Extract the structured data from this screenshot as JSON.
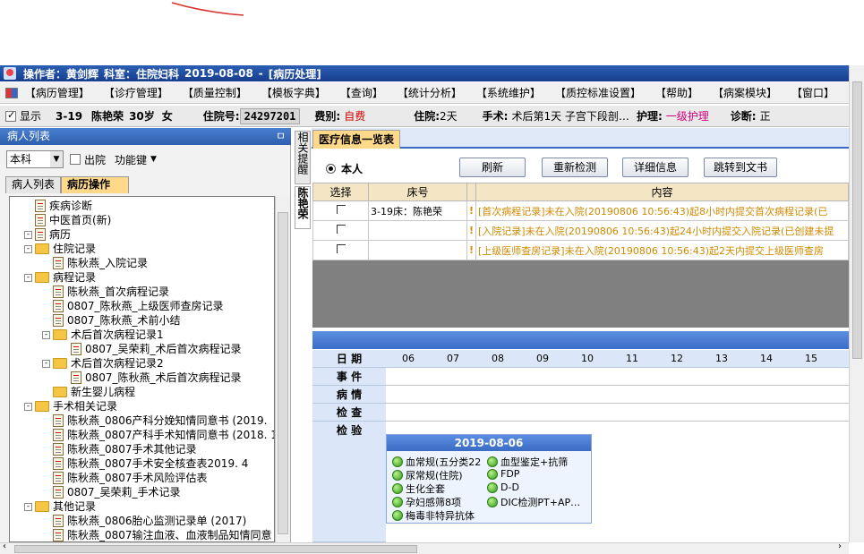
{
  "titlebar": {
    "operator": "操作者：黄剑辉",
    "dept": "科室：住院妇科",
    "date": "2019-08-08",
    "sep": "-",
    "mode": "[病历处理]"
  },
  "menubar": [
    "【病历管理】",
    "【诊疗管理】",
    "【质量控制】",
    "【模板字典】",
    "【查询】",
    "【统计分析】",
    "【系统维护】",
    "【质控标准设置】",
    "【帮助】",
    "【病案模块】",
    "【窗口】"
  ],
  "infobar": {
    "show_label": "显示",
    "bed": "3-19",
    "patient_name": "陈艳荣",
    "age": "30岁",
    "sex": "女",
    "admission_no_label": "住院号:",
    "admission_no": "24297201",
    "fee_type_label": "费别:",
    "fee_type": "自费",
    "stay_label": "住院:",
    "stay": "2天",
    "surgery_label": "手术:",
    "surgery": "术后第1天  子宫下段剖…",
    "care_label": "护理:",
    "care": "一级护理",
    "diagnosis_label": "诊断:",
    "diagnosis": "正"
  },
  "left": {
    "header": "病人列表",
    "pin": "ㅁ",
    "dept_select": "本科",
    "discharged_label": "出院",
    "function_key": "功能键",
    "tabs": [
      "病人列表",
      "病历操作"
    ],
    "tree": [
      {
        "label": "疾病诊断",
        "type": "doc",
        "level": 1
      },
      {
        "label": "中医首页(新)",
        "type": "doc",
        "level": 1
      },
      {
        "label": "病历",
        "type": "doc",
        "level": 1,
        "expand": "-"
      },
      {
        "label": "住院记录",
        "type": "folder",
        "level": 2,
        "expand": "-"
      },
      {
        "label": "陈秋燕_入院记录",
        "type": "doc",
        "level": 3
      },
      {
        "label": "病程记录",
        "type": "folder",
        "level": 2,
        "expand": "-"
      },
      {
        "label": "陈秋燕_首次病程记录",
        "type": "doc",
        "level": 3
      },
      {
        "label": "0807_陈秋燕_上级医师查房记录",
        "type": "doc",
        "level": 3
      },
      {
        "label": "0807_陈秋燕_术前小结",
        "type": "doc",
        "level": 3
      },
      {
        "label": "术后首次病程记录1",
        "type": "folder",
        "level": 3,
        "expand": "-"
      },
      {
        "label": "0807_吴荣莉_术后首次病程记录",
        "type": "doc",
        "level": 4
      },
      {
        "label": "术后首次病程记录2",
        "type": "folder",
        "level": 3,
        "expand": "-"
      },
      {
        "label": "0807_陈秋燕_术后首次病程记录",
        "type": "doc",
        "level": 4
      },
      {
        "label": "新生婴儿病程",
        "type": "folder",
        "level": 3
      },
      {
        "label": "手术相关记录",
        "type": "folder",
        "level": 2,
        "expand": "-"
      },
      {
        "label": "陈秋燕_0806产科分娩知情同意书 (2019.",
        "type": "doc",
        "level": 3
      },
      {
        "label": "陈秋燕_0807产科手术知情同意书 (2018. 1",
        "type": "doc",
        "level": 3
      },
      {
        "label": "陈秋燕_0807手术其他记录",
        "type": "doc",
        "level": 3
      },
      {
        "label": "陈秋燕_0807手术安全核查表2019. 4",
        "type": "doc",
        "level": 3
      },
      {
        "label": "陈秋燕_0807手术风险评估表",
        "type": "doc",
        "level": 3
      },
      {
        "label": "0807_吴荣莉_手术记录",
        "type": "doc",
        "level": 3
      },
      {
        "label": "其他记录",
        "type": "folder",
        "level": 2,
        "expand": "-"
      },
      {
        "label": "陈秋燕_0806胎心监测记录单 (2017)",
        "type": "doc",
        "level": 3
      },
      {
        "label": "陈秋燕_0807输注血液、血液制品知情同意",
        "type": "doc",
        "level": 3
      }
    ]
  },
  "vtabs": [
    "相关提醒",
    "陈艳荣"
  ],
  "right": {
    "tab": "医疗信息一览表",
    "radio_label": "本人",
    "buttons": [
      "刷新",
      "重新检测",
      "详细信息",
      "跳转到文书"
    ],
    "grid": {
      "headers": [
        "选择",
        "床号",
        "",
        "内容"
      ],
      "rows": [
        {
          "bed": "3-19床：陈艳荣",
          "flag": "!",
          "content": "[首次病程记录]未在入院(20190806  10:56:43)起8小时内提交首次病程记录(已"
        },
        {
          "bed": "",
          "flag": "!",
          "content": "[入院记录]未在入院(20190806  10:56:43)起24小时内提交入院记录(已创建未提"
        },
        {
          "bed": "",
          "flag": "!",
          "content": "[上级医师查房记录]未在入院(20190806  10:56:43)起2天内提交上级医师查房"
        }
      ]
    },
    "timeline": {
      "labels": [
        "日  期",
        "事  件",
        "病  情",
        "检  查",
        "检  验"
      ],
      "dates": [
        "06",
        "07",
        "08",
        "09",
        "10",
        "11",
        "12",
        "13",
        "14",
        "15"
      ],
      "popup": {
        "date": "2019-08-06",
        "items_left": [
          "血常规(五分类22",
          "尿常规(住院)",
          "生化全套",
          "孕妇感筛8项",
          "梅毒非特异抗体"
        ],
        "items_right": [
          "血型鉴定+抗筛",
          "FDP",
          "D-D",
          "DIC检测PT+AP…"
        ]
      }
    }
  },
  "colors": {
    "title_blue": "#173e8d",
    "tab_active": "#ffd98a",
    "warning_text": "#d08a00",
    "fee_red": "#d00000",
    "care_pink": "#d0007a"
  }
}
